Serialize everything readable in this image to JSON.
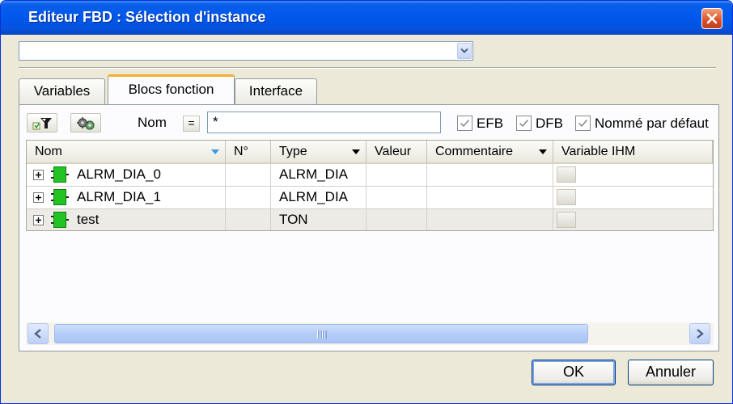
{
  "window": {
    "title": "Editeur FBD : Sélection d'instance"
  },
  "instance_combo": {
    "value": ""
  },
  "tabs": [
    {
      "label": "Variables",
      "active": false
    },
    {
      "label": "Blocs fonction",
      "active": true
    },
    {
      "label": "Interface",
      "active": false
    }
  ],
  "filter": {
    "filter_icon": "filter-icon",
    "settings_icon": "gears-icon",
    "name_label": "Nom",
    "eq_label": "=",
    "name_value": "*",
    "checkboxes": [
      {
        "label": "EFB",
        "checked": true
      },
      {
        "label": "DFB",
        "checked": true
      },
      {
        "label": "Nommé par défaut",
        "checked": true
      }
    ]
  },
  "grid": {
    "columns": [
      "Nom",
      "N°",
      "Type",
      "Valeur",
      "Commentaire",
      "Variable IHM"
    ],
    "rows": [
      {
        "name": "ALRM_DIA_0",
        "number": "",
        "type": "ALRM_DIA",
        "value": "",
        "comment": ""
      },
      {
        "name": "ALRM_DIA_1",
        "number": "",
        "type": "ALRM_DIA",
        "value": "",
        "comment": ""
      },
      {
        "name": "test",
        "number": "",
        "type": "TON",
        "value": "",
        "comment": ""
      }
    ]
  },
  "buttons": {
    "ok": "OK",
    "cancel": "Annuler"
  },
  "colors": {
    "title_bar": "#0058ee",
    "fb_icon": "#22c322",
    "tab_highlight": "#f0b030"
  }
}
